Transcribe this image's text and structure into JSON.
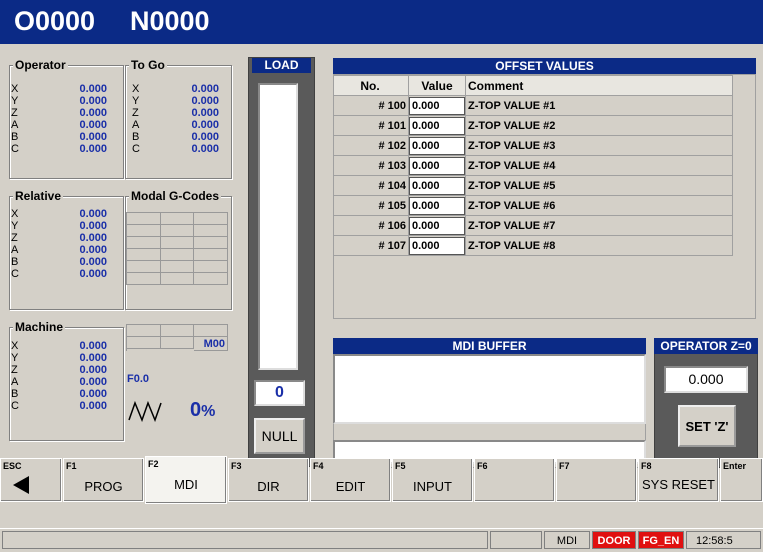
{
  "header": {
    "program": "O0000",
    "sequence": "N0000"
  },
  "operator": {
    "title": "Operator",
    "axes": [
      {
        "label": "X",
        "value": "0.000"
      },
      {
        "label": "Y",
        "value": "0.000"
      },
      {
        "label": "Z",
        "value": "0.000"
      },
      {
        "label": "A",
        "value": "0.000"
      },
      {
        "label": "B",
        "value": "0.000"
      },
      {
        "label": "C",
        "value": "0.000"
      }
    ]
  },
  "togo": {
    "title": "To Go",
    "axes": [
      {
        "label": "X",
        "value": "0.000"
      },
      {
        "label": "Y",
        "value": "0.000"
      },
      {
        "label": "Z",
        "value": "0.000"
      },
      {
        "label": "A",
        "value": "0.000"
      },
      {
        "label": "B",
        "value": "0.000"
      },
      {
        "label": "C",
        "value": "0.000"
      }
    ]
  },
  "relative": {
    "title": "Relative",
    "axes": [
      {
        "label": "X",
        "value": "0.000"
      },
      {
        "label": "Y",
        "value": "0.000"
      },
      {
        "label": "Z",
        "value": "0.000"
      },
      {
        "label": "A",
        "value": "0.000"
      },
      {
        "label": "B",
        "value": "0.000"
      },
      {
        "label": "C",
        "value": "0.000"
      }
    ]
  },
  "machine": {
    "title": "Machine",
    "axes": [
      {
        "label": "X",
        "value": "0.000"
      },
      {
        "label": "Y",
        "value": "0.000"
      },
      {
        "label": "Z",
        "value": "0.000"
      },
      {
        "label": "A",
        "value": "0.000"
      },
      {
        "label": "B",
        "value": "0.000"
      },
      {
        "label": "C",
        "value": "0.000"
      }
    ]
  },
  "modal": {
    "title": "Modal G-Codes",
    "mcode": "M00",
    "feed": "F0.0",
    "spindle_pct": "0",
    "pct_sign": "%"
  },
  "load": {
    "title": "LOAD",
    "value": "0",
    "null_label": "NULL"
  },
  "offsets": {
    "title": "OFFSET VALUES",
    "col_no": "No.",
    "col_value": "Value",
    "col_comment": "Comment",
    "rows": [
      {
        "no": "# 100",
        "value": "0.000",
        "comment": "Z-TOP VALUE #1"
      },
      {
        "no": "# 101",
        "value": "0.000",
        "comment": "Z-TOP VALUE #2"
      },
      {
        "no": "# 102",
        "value": "0.000",
        "comment": "Z-TOP VALUE #3"
      },
      {
        "no": "# 103",
        "value": "0.000",
        "comment": "Z-TOP VALUE #4"
      },
      {
        "no": "# 104",
        "value": "0.000",
        "comment": "Z-TOP VALUE #5"
      },
      {
        "no": "# 105",
        "value": "0.000",
        "comment": "Z-TOP VALUE #6"
      },
      {
        "no": "# 106",
        "value": "0.000",
        "comment": "Z-TOP VALUE #7"
      },
      {
        "no": "# 107",
        "value": "0.000",
        "comment": "Z-TOP VALUE #8"
      }
    ]
  },
  "mdi": {
    "title": "MDI BUFFER",
    "buffer": "",
    "input": ""
  },
  "operator_z": {
    "title": "OPERATOR Z=0",
    "value": "0.000",
    "button": "SET 'Z'"
  },
  "fkeys": [
    {
      "key": "ESC",
      "label": ""
    },
    {
      "key": "F1",
      "label": "PROG"
    },
    {
      "key": "F2",
      "label": "MDI"
    },
    {
      "key": "F3",
      "label": "DIR"
    },
    {
      "key": "F4",
      "label": "EDIT"
    },
    {
      "key": "F5",
      "label": "INPUT"
    },
    {
      "key": "F6",
      "label": ""
    },
    {
      "key": "F7",
      "label": ""
    },
    {
      "key": "F8",
      "label": "SYS RESET"
    },
    {
      "key": "Enter",
      "label": ""
    }
  ],
  "status": {
    "mode": "MDI",
    "door": "DOOR",
    "fg": "FG_EN",
    "time": "12:58:5",
    "door_color": "#e01010",
    "fg_color": "#e01010"
  }
}
